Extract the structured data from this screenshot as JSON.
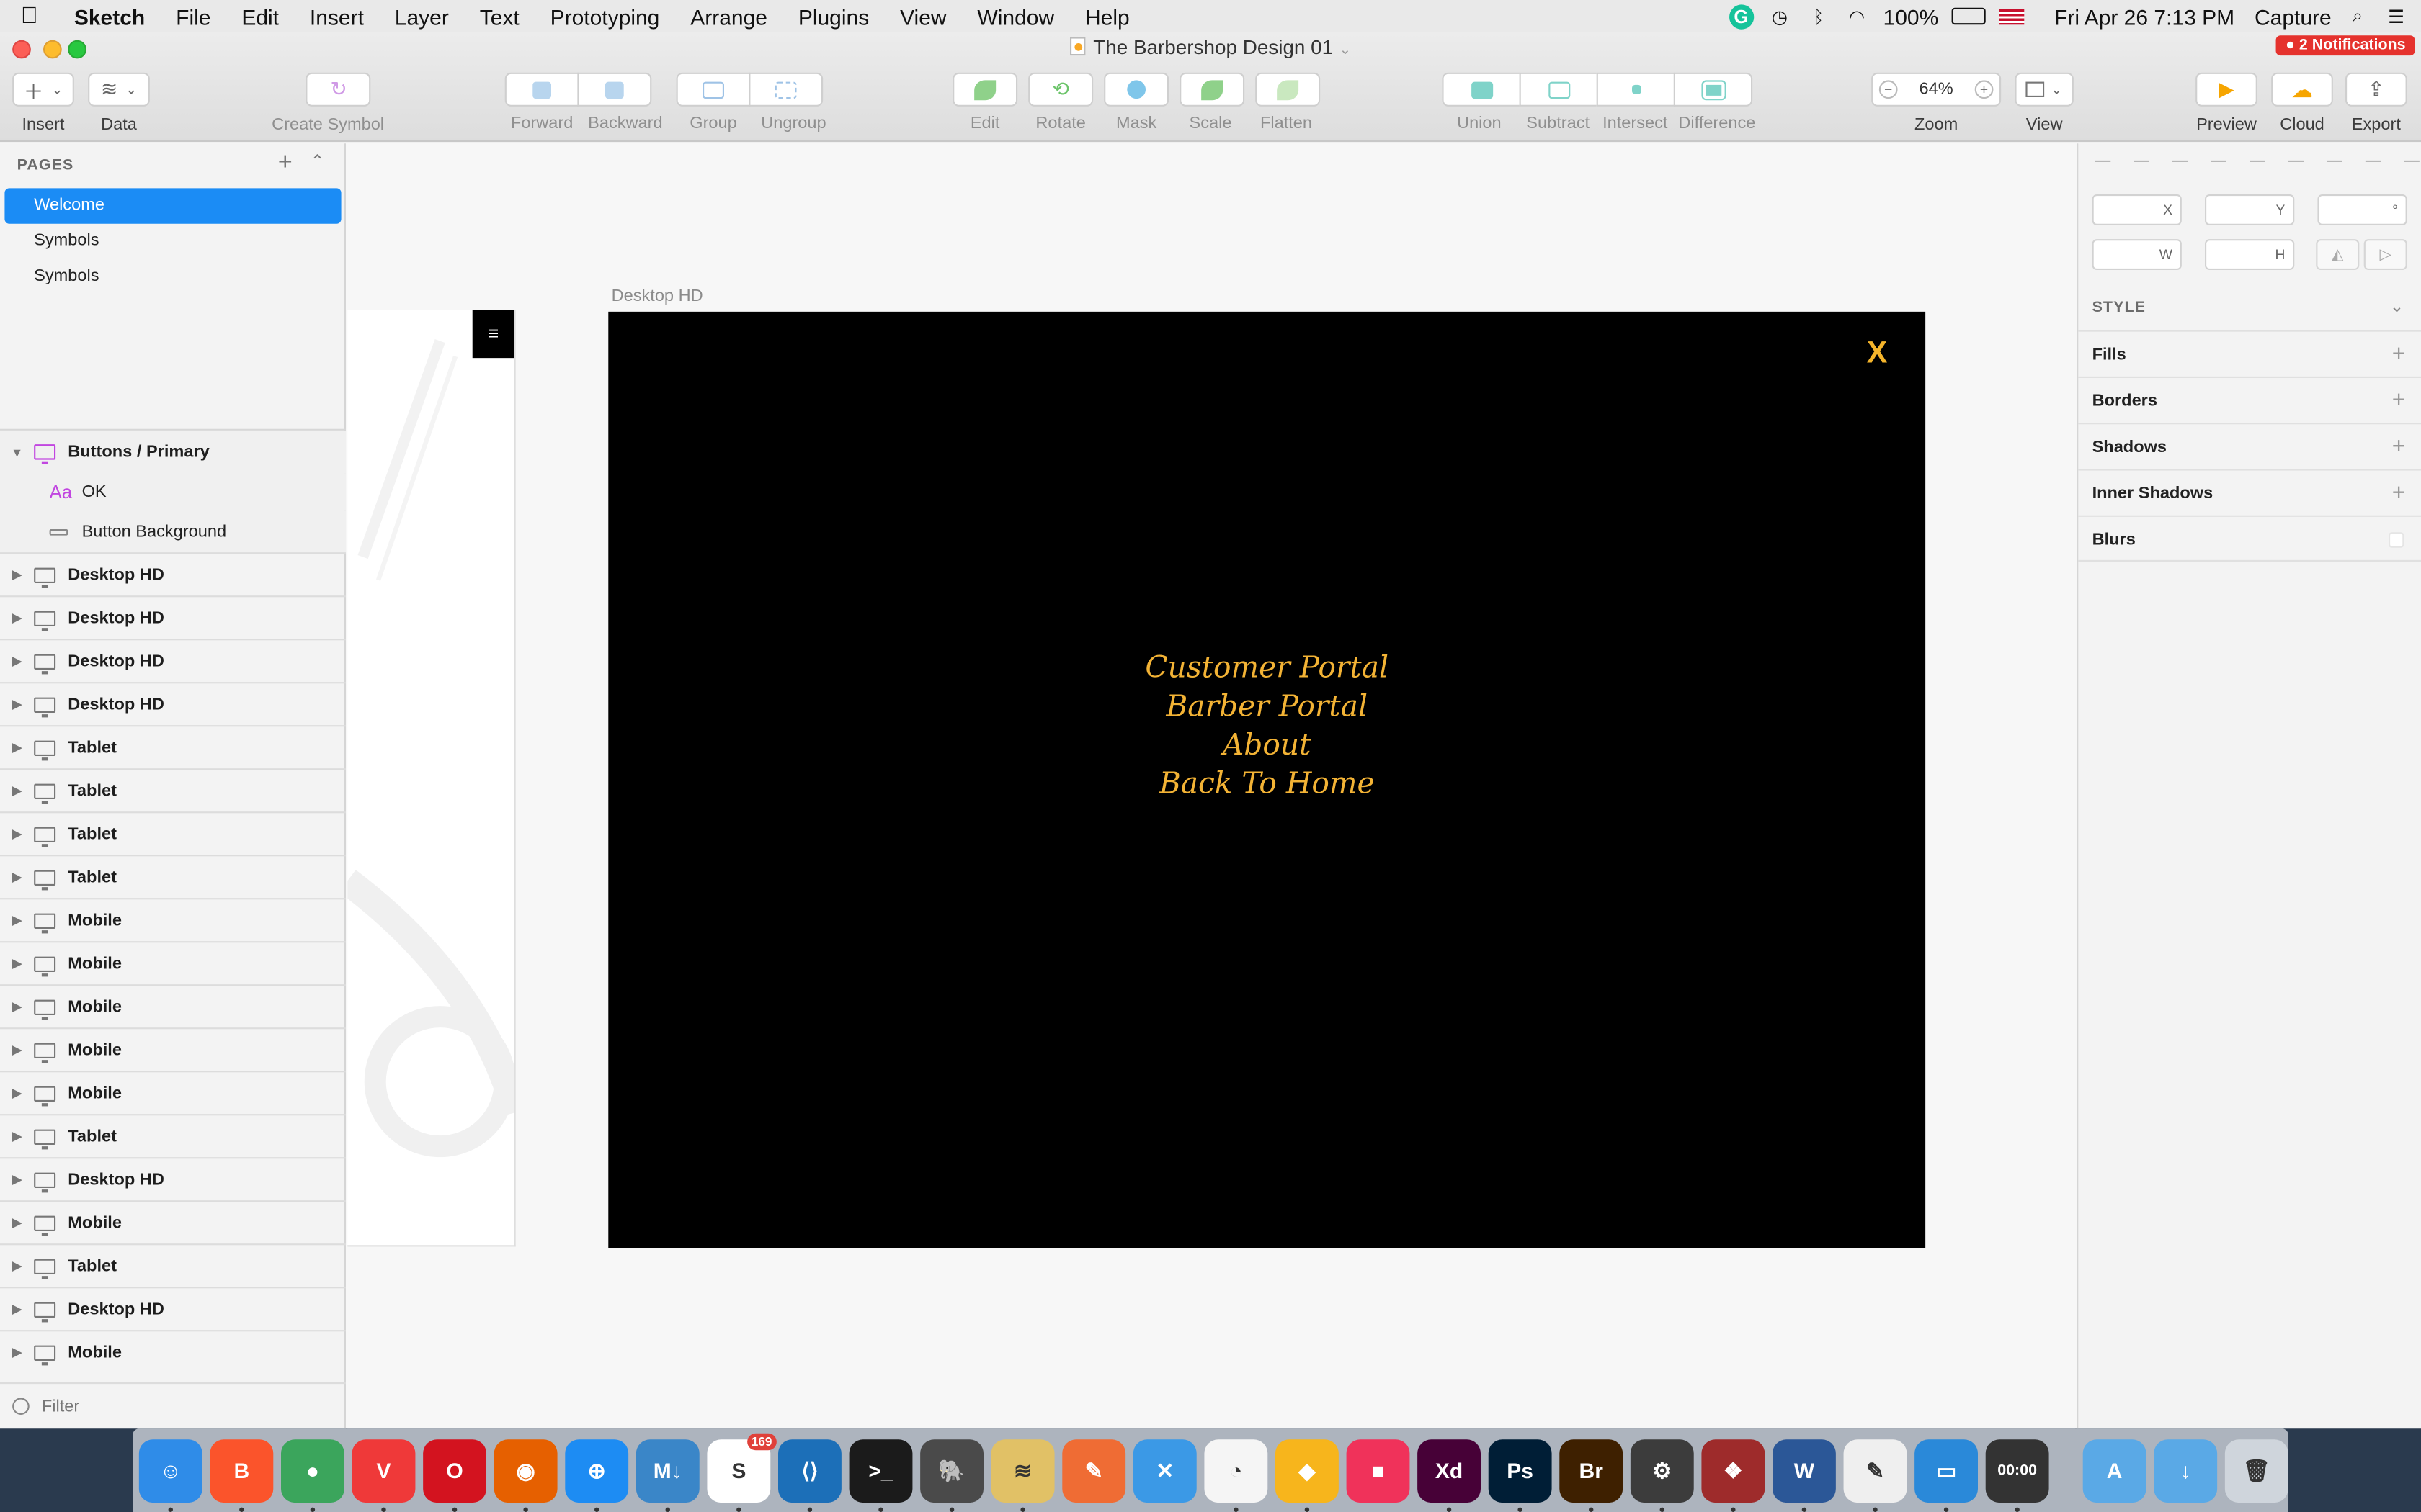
{
  "menubar": {
    "app_name": "Sketch",
    "items": [
      "File",
      "Edit",
      "Insert",
      "Layer",
      "Text",
      "Prototyping",
      "Arrange",
      "Plugins",
      "View",
      "Window",
      "Help"
    ],
    "battery": "100%",
    "datetime": "Fri Apr 26  7:13 PM",
    "capture": "Capture"
  },
  "window": {
    "title": "The Barbershop Design 01",
    "notifications": "2 Notifications"
  },
  "toolbar": {
    "insert": "Insert",
    "data": "Data",
    "create_symbol": "Create Symbol",
    "forward": "Forward",
    "backward": "Backward",
    "group": "Group",
    "ungroup": "Ungroup",
    "edit": "Edit",
    "rotate": "Rotate",
    "mask": "Mask",
    "scale": "Scale",
    "flatten": "Flatten",
    "union": "Union",
    "subtract": "Subtract",
    "intersect": "Intersect",
    "difference": "Difference",
    "zoom_value": "64%",
    "zoom": "Zoom",
    "view": "View",
    "preview": "Preview",
    "cloud": "Cloud",
    "export": "Export",
    "zoom_out": "−",
    "zoom_in": "+"
  },
  "sidebar": {
    "pages_heading": "PAGES",
    "pages": [
      "Welcome",
      "Symbols",
      "Symbols"
    ],
    "active_page": "Welcome",
    "symbol_group": {
      "name": "Buttons / Primary",
      "children": [
        {
          "kind": "text",
          "name": "OK"
        },
        {
          "kind": "shape",
          "name": "Button Background"
        }
      ]
    },
    "artboards": [
      "Desktop HD",
      "Desktop HD",
      "Desktop HD",
      "Desktop HD",
      "Tablet",
      "Tablet",
      "Tablet",
      "Tablet",
      "Mobile",
      "Mobile",
      "Mobile",
      "Mobile",
      "Mobile",
      "Tablet",
      "Desktop HD",
      "Mobile",
      "Tablet",
      "Desktop HD",
      "Mobile"
    ],
    "filter": "Filter"
  },
  "canvas": {
    "artboard_label": "Desktop HD",
    "close_label": "X",
    "menu_icon": "≡",
    "nav_links": [
      "Customer Portal",
      "Barber Portal",
      "About",
      "Back To Home"
    ],
    "nav_color": "#f3b335"
  },
  "inspector": {
    "x_label": "X",
    "y_label": "Y",
    "rotation_label": "°",
    "w_label": "W",
    "h_label": "H",
    "style_heading": "STYLE",
    "sections": [
      "Fills",
      "Borders",
      "Shadows",
      "Inner Shadows",
      "Blurs"
    ]
  },
  "dock": {
    "apps": [
      {
        "name": "Finder",
        "color": "#2f8ce8",
        "glyph": "☺"
      },
      {
        "name": "Brave",
        "color": "#fb542b",
        "glyph": "B"
      },
      {
        "name": "Chrome",
        "color": "#3ba55c",
        "glyph": "●"
      },
      {
        "name": "Vivaldi",
        "color": "#ef3939",
        "glyph": "V"
      },
      {
        "name": "Opera",
        "color": "#d3131f",
        "glyph": "O"
      },
      {
        "name": "Firefox",
        "color": "#e66000",
        "glyph": "◉"
      },
      {
        "name": "Safari",
        "color": "#1d8cf3",
        "glyph": "⊕"
      },
      {
        "name": "Markdown",
        "color": "#3a86c8",
        "glyph": "M↓"
      },
      {
        "name": "Slack",
        "color": "#ffffff",
        "glyph": "S",
        "badge": "169"
      },
      {
        "name": "VS Code",
        "color": "#1c6fb8",
        "glyph": "⟨⟩"
      },
      {
        "name": "Terminal",
        "color": "#1b1b1b",
        "glyph": ">_"
      },
      {
        "name": "TablePlus",
        "color": "#4a4a4a",
        "glyph": "🐘"
      },
      {
        "name": "Sequel",
        "color": "#e1c166",
        "glyph": "≋"
      },
      {
        "name": "Postman",
        "color": "#ef6c34",
        "glyph": "✎"
      },
      {
        "name": "Xcode",
        "color": "#3b99e6",
        "glyph": "✕"
      },
      {
        "name": "Clock",
        "color": "#f5f5f5",
        "glyph": "◔"
      },
      {
        "name": "Sketch",
        "color": "#f7b51c",
        "glyph": "◆"
      },
      {
        "name": "Screens",
        "color": "#f0325a",
        "glyph": "■"
      },
      {
        "name": "Adobe XD",
        "color": "#470137",
        "glyph": "Xd"
      },
      {
        "name": "Photoshop",
        "color": "#001e36",
        "glyph": "Ps"
      },
      {
        "name": "Bridge",
        "color": "#3e2000",
        "glyph": "Br"
      },
      {
        "name": "Compressor",
        "color": "#3c3c3c",
        "glyph": "⚙"
      },
      {
        "name": "Photo Booth",
        "color": "#9e2b2b",
        "glyph": "❖"
      },
      {
        "name": "Word",
        "color": "#2b5797",
        "glyph": "W"
      },
      {
        "name": "TextEdit",
        "color": "#efefef",
        "glyph": "✎"
      },
      {
        "name": "Keynote",
        "color": "#2a89d9",
        "glyph": "▭"
      },
      {
        "name": "Timer",
        "color": "#333333",
        "glyph": "00:00"
      },
      {
        "name": "Applications",
        "color": "#5aa9e6",
        "glyph": "A"
      },
      {
        "name": "Downloads",
        "color": "#5aa9e6",
        "glyph": "↓"
      },
      {
        "name": "Trash",
        "color": "#cfd5dc",
        "glyph": "🗑"
      }
    ]
  }
}
